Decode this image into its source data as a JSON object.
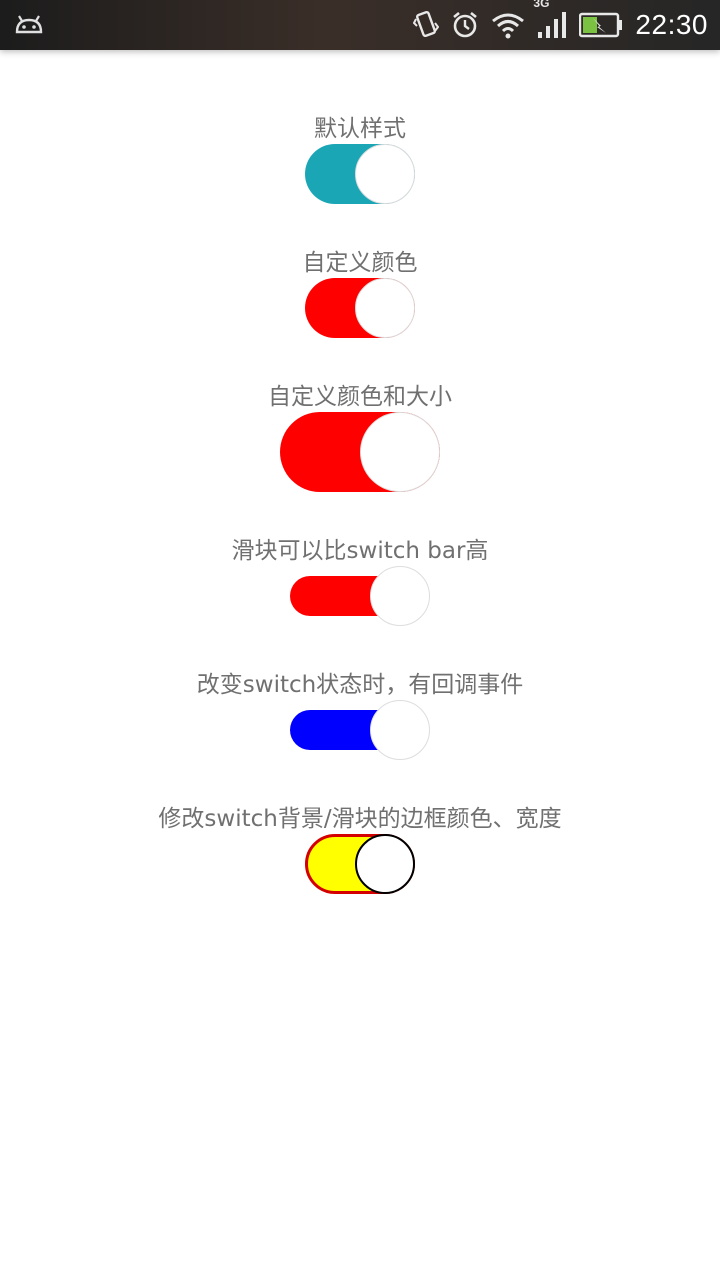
{
  "status_bar": {
    "time": "22:30",
    "network": "3G",
    "icons": [
      "android-icon",
      "vibrate-icon",
      "alarm-icon",
      "wifi-icon",
      "signal-icon",
      "battery-charging-icon"
    ]
  },
  "switches": [
    {
      "label": "默认样式",
      "checked": true,
      "track_color": "#1ba6b6",
      "thumb_border_color": "#dddddd"
    },
    {
      "label": "自定义颜色",
      "checked": true,
      "track_color": "#ff0000",
      "thumb_border_color": "#dddddd"
    },
    {
      "label": "自定义颜色和大小",
      "checked": true,
      "track_color": "#ff0000",
      "thumb_border_color": "#dddddd"
    },
    {
      "label": "滑块可以比switch bar高",
      "checked": true,
      "track_color": "#ff0000",
      "thumb_border_color": "#dddddd"
    },
    {
      "label": "改变switch状态时，有回调事件",
      "checked": true,
      "track_color": "#0000ff",
      "thumb_border_color": "#dddddd"
    },
    {
      "label": "修改switch背景/滑块的边框颜色、宽度",
      "checked": true,
      "track_color": "#ffff00",
      "track_border_color": "#d40000",
      "thumb_border_color": "#000000"
    }
  ]
}
